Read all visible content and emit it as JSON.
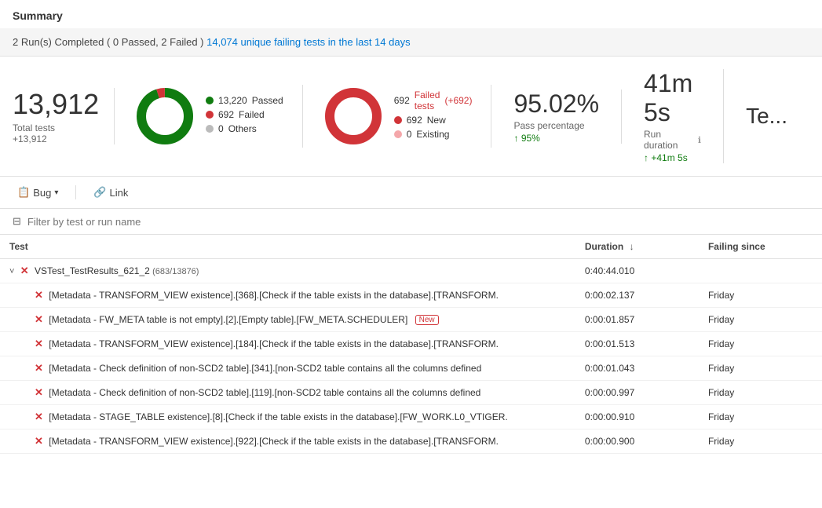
{
  "page": {
    "summary_title": "Summary",
    "run_info": "2 Run(s) Completed ( 0 Passed, 2 Failed )",
    "run_link_text": "14,074 unique failing tests in the last 14 days",
    "total_tests_num": "13,912",
    "total_tests_label": "Total tests",
    "total_tests_delta": "+13,912",
    "passed_count": "13,220",
    "failed_count": "692",
    "others_count": "0",
    "passed_label": "Passed",
    "failed_label": "Failed",
    "others_label": "Others",
    "failed_tests_count": "692",
    "failed_tests_label": "Failed tests",
    "failed_tests_delta": "(+692)",
    "new_count": "692",
    "new_label": "New",
    "existing_count": "0",
    "existing_label": "Existing",
    "pass_pct": "95.02%",
    "pass_pct_label": "Pass percentage",
    "pass_pct_delta": "↑ 95%",
    "run_duration": "41m 5s",
    "run_duration_label": "Run duration",
    "run_duration_delta": "↑ +41m 5s",
    "tes_label": "Te...",
    "toolbar": {
      "bug_label": "Bug",
      "link_label": "Link"
    },
    "filter_placeholder": "Filter by test or run name",
    "table": {
      "col_test": "Test",
      "col_duration": "Duration",
      "col_failing_since": "Failing since",
      "rows": [
        {
          "type": "group",
          "indent": 0,
          "name": "VSTest_TestResults_621_2",
          "sub": "(683/13876)",
          "duration": "0:40:44.010",
          "failing_since": "",
          "is_new": false
        },
        {
          "type": "test",
          "indent": 1,
          "name": "[Metadata - TRANSFORM_VIEW existence].[368].[Check if the table exists in the database].[TRANSFORM.",
          "duration": "0:00:02.137",
          "failing_since": "Friday",
          "is_new": false
        },
        {
          "type": "test",
          "indent": 1,
          "name": "[Metadata - FW_META table is not empty].[2].[Empty table].[FW_META.SCHEDULER]",
          "duration": "0:00:01.857",
          "failing_since": "Friday",
          "is_new": true
        },
        {
          "type": "test",
          "indent": 1,
          "name": "[Metadata - TRANSFORM_VIEW existence].[184].[Check if the table exists in the database].[TRANSFORM.",
          "duration": "0:00:01.513",
          "failing_since": "Friday",
          "is_new": false
        },
        {
          "type": "test",
          "indent": 1,
          "name": "[Metadata - Check definition of non-SCD2 table].[341].[non-SCD2 table contains all the columns defined",
          "duration": "0:00:01.043",
          "failing_since": "Friday",
          "is_new": false
        },
        {
          "type": "test",
          "indent": 1,
          "name": "[Metadata - Check definition of non-SCD2 table].[119].[non-SCD2 table contains all the columns defined",
          "duration": "0:00:00.997",
          "failing_since": "Friday",
          "is_new": false
        },
        {
          "type": "test",
          "indent": 1,
          "name": "[Metadata - STAGE_TABLE existence].[8].[Check if the table exists in the database].[FW_WORK.L0_VTIGER.",
          "duration": "0:00:00.910",
          "failing_since": "Friday",
          "is_new": false
        },
        {
          "type": "test",
          "indent": 1,
          "name": "[Metadata - TRANSFORM_VIEW existence].[922].[Check if the table exists in the database].[TRANSFORM.",
          "duration": "0:00:00.900",
          "failing_since": "Friday",
          "is_new": false
        }
      ]
    }
  }
}
